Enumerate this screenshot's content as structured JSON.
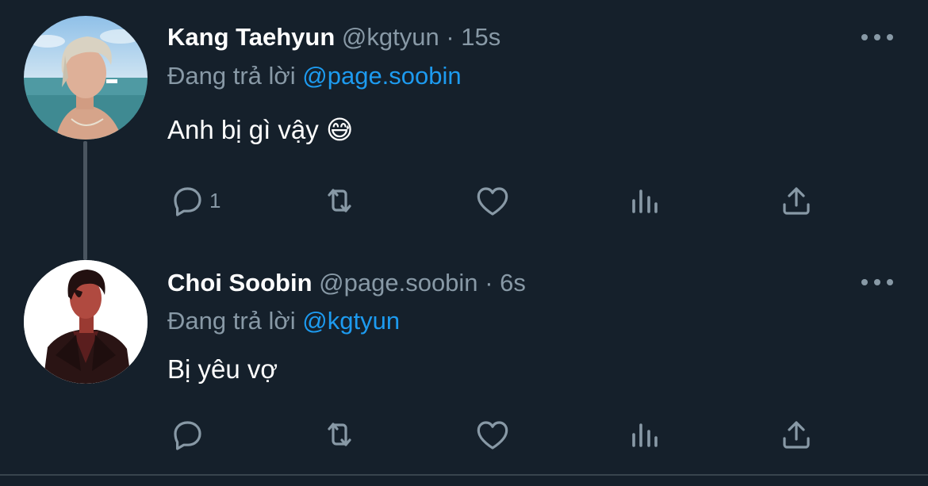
{
  "tweets": [
    {
      "display_name": "Kang Taehyun",
      "handle": "@kgtyun",
      "separator": "·",
      "time": "15s",
      "replying_prefix": "Đang trả lời",
      "replying_to": "@page.soobin",
      "text": "Anh bị gì vậy 😅",
      "reply_count": "1",
      "avatar_icon": "profile-photo"
    },
    {
      "display_name": "Choi Soobin",
      "handle": "@page.soobin",
      "separator": "·",
      "time": "6s",
      "replying_prefix": "Đang trả lời",
      "replying_to": "@kgtyun",
      "text": "Bị yêu vợ",
      "reply_count": "",
      "avatar_icon": "profile-photo"
    }
  ],
  "icons": {
    "reply": "reply-icon",
    "retweet": "retweet-icon",
    "like": "heart-icon",
    "analytics": "analytics-icon",
    "share": "share-icon",
    "more": "more-icon"
  },
  "colors": {
    "background": "#15202b",
    "text": "#ffffff",
    "muted": "#8899a6",
    "link": "#1d9bf0",
    "thread_line": "#4a5560"
  }
}
